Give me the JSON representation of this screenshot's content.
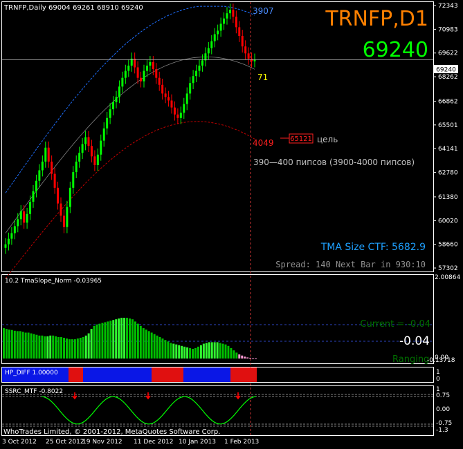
{
  "main": {
    "header": "TRNFP,Daily  69004 69261 68910 69240",
    "symbol_title": "TRNFP,D1",
    "last_price": "69240",
    "price_tag": "69240",
    "price_axis": [
      "72343",
      "70983",
      "69622",
      "68262",
      "66862",
      "65501",
      "64141",
      "62780",
      "61380",
      "60020",
      "58660",
      "57302"
    ],
    "upper_band_label": "3907",
    "lower_band_label": "4049",
    "current_label": "71",
    "target_box": "65121",
    "target_word": "цель",
    "range_note": "390—400 пипсов (3900-4000 пипсов)",
    "tma_size": "TMA Size CTF: 5682.9",
    "spread": "Spread: 140 Next Bar in 930:10"
  },
  "slope": {
    "label": "10.2 TmaSlope_Norm -0.03965",
    "axis": [
      "2.00864",
      "0.00",
      "-0.13718"
    ],
    "current_text": "Current = -0.04",
    "value_text": "-0.04",
    "ranging_text": "Ranging",
    "values": [
      0.82,
      0.8,
      0.78,
      0.77,
      0.75,
      0.74,
      0.74,
      0.72,
      0.7,
      0.7,
      0.68,
      0.66,
      0.64,
      0.62,
      0.62,
      0.6,
      0.6,
      0.62,
      0.62,
      0.6,
      0.58,
      0.58,
      0.56,
      0.54,
      0.52,
      0.52,
      0.52,
      0.54,
      0.56,
      0.58,
      0.62,
      0.68,
      0.8,
      0.88,
      0.92,
      0.94,
      0.96,
      0.98,
      1.0,
      1.02,
      1.04,
      1.06,
      1.08,
      1.1,
      1.1,
      1.1,
      1.08,
      1.06,
      1.0,
      0.94,
      0.88,
      0.82,
      0.78,
      0.74,
      0.7,
      0.66,
      0.62,
      0.58,
      0.54,
      0.5,
      0.46,
      0.42,
      0.4,
      0.38,
      0.36,
      0.34,
      0.32,
      0.3,
      0.28,
      0.26,
      0.28,
      0.32,
      0.36,
      0.4,
      0.42,
      0.44,
      0.44,
      0.44,
      0.44,
      0.42,
      0.4,
      0.38,
      0.34,
      0.28,
      0.22,
      0.16,
      0.11,
      0.08,
      0.05,
      0.03,
      0.02,
      0.0,
      -0.01
    ]
  },
  "hp_diff": {
    "label": "HP_DIFF 1.00000",
    "axis": [
      "1",
      "0"
    ],
    "segments": [
      {
        "color": "blue",
        "from": 0,
        "to": 96
      },
      {
        "color": "red",
        "from": 96,
        "to": 117
      },
      {
        "color": "blue",
        "from": 117,
        "to": 216
      },
      {
        "color": "red",
        "from": 216,
        "to": 262
      },
      {
        "color": "blue",
        "from": 262,
        "to": 330
      },
      {
        "color": "red",
        "from": 330,
        "to": 368
      }
    ]
  },
  "ssrc": {
    "label": "SSRC_MTF -0.8022",
    "axis": [
      "1",
      "0.75",
      "0.00",
      "-0.75",
      "-1.3"
    ]
  },
  "footer": {
    "copyright": "WhoTrades Limited, © 2001-2012, MetaQuotes Software Corp.",
    "dates": [
      "3 Oct 2012",
      "25 Oct 2012",
      "19 Nov 2012",
      "11 Dec 2012",
      "10 Jan 2013",
      "1 Feb 2013"
    ]
  },
  "colors": {
    "bull": "#00ff00",
    "bear": "#ff0000",
    "orange": "#ff8000",
    "band_upper": "#1e6fff",
    "band_lower": "#c00000",
    "tma": "#808080",
    "slope_green": "#00c000",
    "slope_bright": "#32ff32",
    "slope_pink": "#ff9ad5",
    "hp_blue": "#0a17e6",
    "hp_red": "#e01010"
  },
  "chart_data": [
    {
      "type": "candlestick",
      "title": "TRNFP,D1",
      "ylim": [
        57302,
        72343
      ],
      "x_labels": [
        "3 Oct 2012",
        "25 Oct 2012",
        "19 Nov 2012",
        "11 Dec 2012",
        "10 Jan 2013",
        "1 Feb 2013"
      ],
      "close_series": [
        58660,
        58980,
        59300,
        59700,
        60100,
        60550,
        59900,
        60400,
        61100,
        61700,
        62300,
        62900,
        63400,
        64200,
        63400,
        62700,
        61900,
        61000,
        60300,
        59650,
        60800,
        61900,
        62800,
        63400,
        63900,
        64400,
        64800,
        64300,
        63700,
        63200,
        63800,
        64600,
        65300,
        65900,
        66400,
        66800,
        67100,
        67700,
        68200,
        68600,
        68900,
        69300,
        68800,
        68200,
        68000,
        68600,
        68900,
        69100,
        68700,
        68200,
        67800,
        67300,
        67100,
        66900,
        66500,
        66100,
        65900,
        66200,
        66700,
        67300,
        67900,
        68300,
        68600,
        68900,
        69200,
        69600,
        69900,
        70300,
        70700,
        70900,
        71300,
        71600,
        71900,
        72100,
        71700,
        71100,
        70600,
        70000,
        69600,
        69300,
        69150,
        69240
      ],
      "upper_band_end": 72300,
      "lower_band_end": 65100,
      "annotations": [
        "3907",
        "4049",
        "71",
        "65121",
        "цель",
        "390—400 пипсов (3900-4000 пипсов)",
        "TMA Size CTF: 5682.9"
      ]
    },
    {
      "type": "bar",
      "title": "10.2 TmaSlope_Norm -0.03965",
      "ylim": [
        -0.13718,
        2.00864
      ],
      "last_value": -0.04
    },
    {
      "type": "line",
      "title": "SSRC_MTF -0.8022",
      "ylim": [
        -1.3,
        1
      ],
      "last_value": -0.8022
    }
  ]
}
